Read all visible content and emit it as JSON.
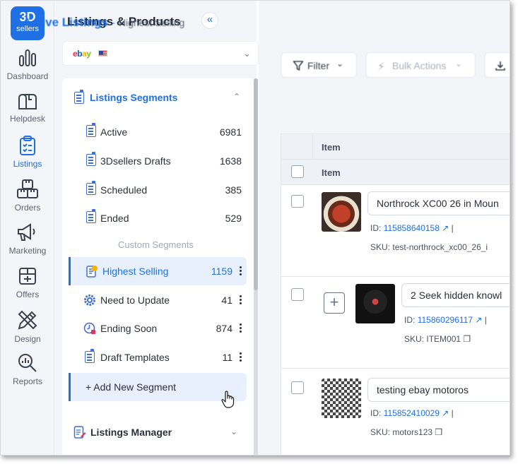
{
  "rail": {
    "logo_line1": "3D",
    "logo_line2": "sellers",
    "items": [
      {
        "label": "Dashboard",
        "icon": "bar-chart-icon"
      },
      {
        "label": "Helpdesk",
        "icon": "mailbox-icon"
      },
      {
        "label": "Listings",
        "icon": "clipboard-icon"
      },
      {
        "label": "Orders",
        "icon": "boxes-icon"
      },
      {
        "label": "Marketing",
        "icon": "megaphone-icon"
      },
      {
        "label": "Offers",
        "icon": "offer-box-icon"
      },
      {
        "label": "Design",
        "icon": "pencil-ruler-icon"
      },
      {
        "label": "Reports",
        "icon": "magnifier-chart-icon"
      }
    ]
  },
  "panel": {
    "title": "Listings & Products",
    "store": {
      "brand": "ebay",
      "flag": "US"
    },
    "segments_header": "Listings Segments",
    "segments": [
      {
        "name": "Active",
        "count": "6981"
      },
      {
        "name": "3Dsellers Drafts",
        "count": "1638"
      },
      {
        "name": "Scheduled",
        "count": "385"
      },
      {
        "name": "Ended",
        "count": "529"
      }
    ],
    "custom_label": "Custom Segments",
    "custom_segments": [
      {
        "name": "Highest Selling",
        "count": "1159",
        "icon": "trophy-icon"
      },
      {
        "name": "Need to Update",
        "count": "41",
        "icon": "gear-icon"
      },
      {
        "name": "Ending Soon",
        "count": "874",
        "icon": "clock-icon"
      },
      {
        "name": "Draft Templates",
        "count": "11",
        "icon": "list-icon"
      }
    ],
    "add_segment": "+ Add New Segment",
    "manager_header": "Listings Manager"
  },
  "main": {
    "title": "Active Listings",
    "separator": "-",
    "subtitle": "Highest Selling",
    "filter_label": "Filter",
    "bulk_label": "Bulk Actions",
    "col_item_1": "Item",
    "col_item_2": "Item",
    "rows": [
      {
        "title": "Northrock XC00 26 in Moun",
        "id_label": "ID:",
        "id": "115858640158",
        "sku_label": "SKU:",
        "sku": "test-northrock_xc00_26_i"
      },
      {
        "title": "2 Seek hidden knowl",
        "id_label": "ID:",
        "id": "115860296117",
        "sku_label": "SKU:",
        "sku": "ITEM001"
      },
      {
        "title": "testing ebay motoros",
        "id_label": "ID:",
        "id": "115852410029",
        "sku_label": "SKU:",
        "sku": "motors123"
      }
    ]
  },
  "colors": {
    "accent": "#1f6fe5",
    "rail_bg": "#f3f5f9",
    "active_bg": "#e8f0fd"
  }
}
